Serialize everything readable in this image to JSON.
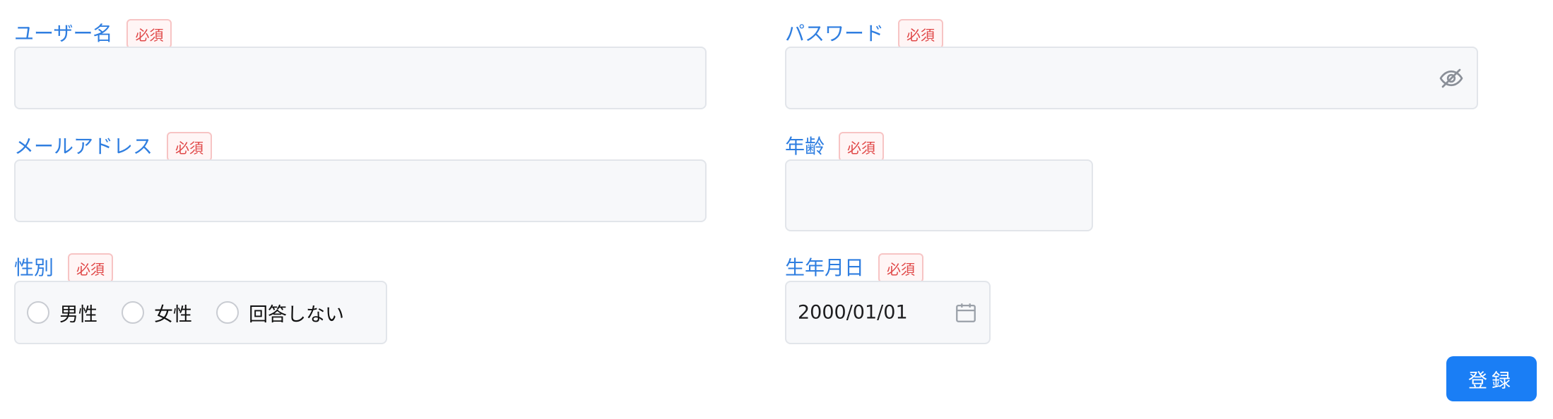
{
  "required_badge": "必須",
  "username": {
    "label": "ユーザー名",
    "value": ""
  },
  "password": {
    "label": "パスワード",
    "value": "",
    "toggle_icon": "eye-slash-icon"
  },
  "email": {
    "label": "メールアドレス",
    "value": ""
  },
  "age": {
    "label": "年齢",
    "value": ""
  },
  "gender": {
    "label": "性別",
    "options": [
      "男性",
      "女性",
      "回答しない"
    ]
  },
  "birthdate": {
    "label": "生年月日",
    "value": "2000/01/01",
    "icon": "calendar-icon"
  },
  "submit_label": "登録",
  "colors": {
    "label": "#2f7ee0",
    "badge_text": "#e04848",
    "badge_border": "#f7c4c4",
    "button": "#1a7ef5",
    "field_bg": "#f7f8fa"
  }
}
